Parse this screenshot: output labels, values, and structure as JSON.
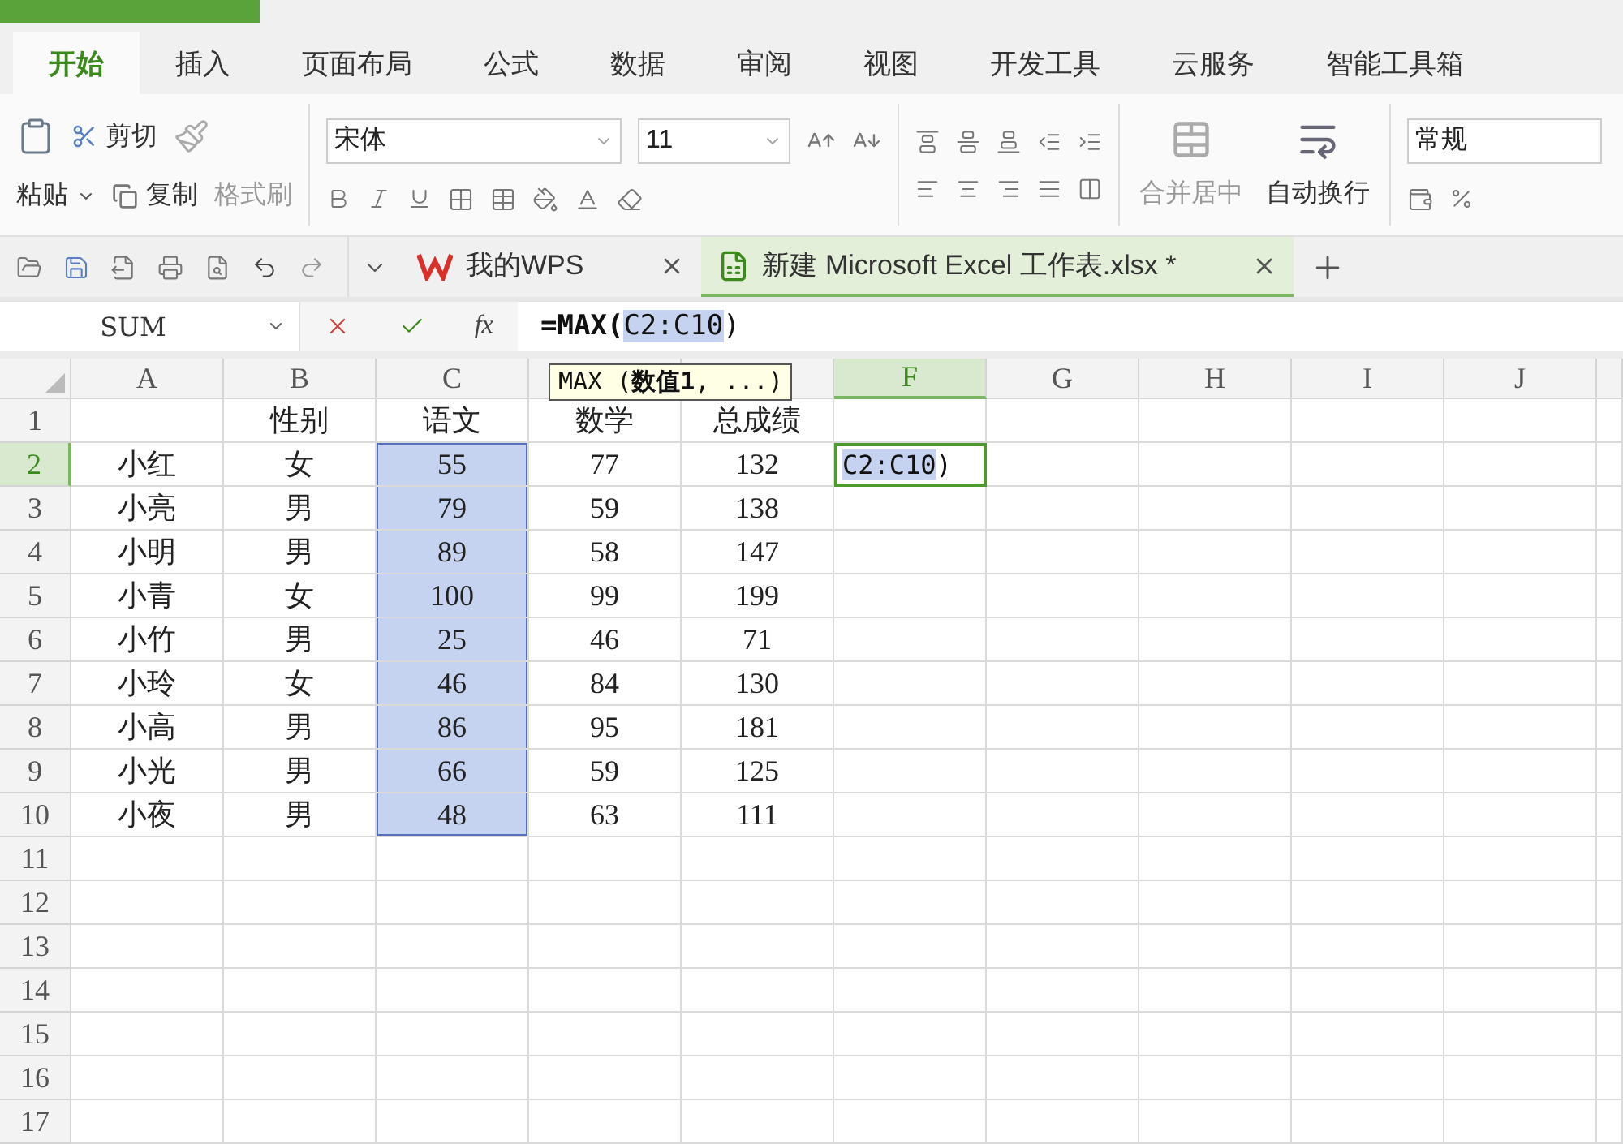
{
  "ribbon_tabs": [
    {
      "label": "开始",
      "selected": true
    },
    {
      "label": "插入",
      "selected": false
    },
    {
      "label": "页面布局",
      "selected": false
    },
    {
      "label": "公式",
      "selected": false
    },
    {
      "label": "数据",
      "selected": false
    },
    {
      "label": "审阅",
      "selected": false
    },
    {
      "label": "视图",
      "selected": false
    },
    {
      "label": "开发工具",
      "selected": false
    },
    {
      "label": "云服务",
      "selected": false
    },
    {
      "label": "智能工具箱",
      "selected": false
    }
  ],
  "clipboard": {
    "paste": "粘贴",
    "cut": "剪切",
    "copy": "复制",
    "format_painter": {
      "label": "格式刷",
      "disabled": true
    }
  },
  "font": {
    "name": "宋体",
    "size": "11"
  },
  "merge": {
    "label": "合并居中",
    "disabled": true
  },
  "wrap": {
    "label": "自动换行",
    "disabled": false
  },
  "number_format": "常规",
  "doc_tabs": [
    {
      "label": "我的WPS",
      "selected": false
    },
    {
      "label": "新建 Microsoft Excel 工作表.xlsx *",
      "selected": true
    }
  ],
  "formula_bar": {
    "name_box": "SUM",
    "function_label": "fx",
    "formula_start": "=MAX(",
    "reference": "C2:C10",
    "formula_end": ")"
  },
  "tooltip": "MAX (**数值1**, ...)",
  "columns": [
    {
      "label": "A",
      "selected": false
    },
    {
      "label": "B",
      "selected": false
    },
    {
      "label": "C",
      "selected": false
    },
    {
      "selected": false
    },
    {
      "selected": false
    },
    {
      "label": "F",
      "selected": true
    },
    {
      "label": "G",
      "selected": false
    },
    {
      "label": "H",
      "selected": false
    },
    {
      "label": "I",
      "selected": false
    },
    {
      "label": "J",
      "selected": false
    }
  ],
  "editor": {
    "reference": "C2:C10",
    "after": ")"
  },
  "rows": [
    {
      "number": "1",
      "selected": false,
      "cells": [
        {
          "highlighted": false
        },
        {
          "text": "性别",
          "highlighted": false
        },
        {
          "text": "语文",
          "highlighted": false
        },
        {
          "text": "数学",
          "highlighted": false
        },
        {
          "text": "总成绩",
          "highlighted": false
        }
      ]
    },
    {
      "number": "2",
      "selected": true,
      "cells": [
        {
          "text": "小红",
          "highlighted": false
        },
        {
          "text": "女",
          "highlighted": false
        },
        {
          "text": "55",
          "highlighted": true
        },
        {
          "text": "77",
          "highlighted": false
        },
        {
          "text": "132",
          "highlighted": false
        }
      ]
    },
    {
      "number": "3",
      "selected": false,
      "cells": [
        {
          "text": "小亮",
          "highlighted": false
        },
        {
          "text": "男",
          "highlighted": false
        },
        {
          "text": "79",
          "highlighted": true
        },
        {
          "text": "59",
          "highlighted": false
        },
        {
          "text": "138",
          "highlighted": false
        }
      ]
    },
    {
      "number": "4",
      "selected": false,
      "cells": [
        {
          "text": "小明",
          "highlighted": false
        },
        {
          "text": "男",
          "highlighted": false
        },
        {
          "text": "89",
          "highlighted": true
        },
        {
          "text": "58",
          "highlighted": false
        },
        {
          "text": "147",
          "highlighted": false
        }
      ]
    },
    {
      "number": "5",
      "selected": false,
      "cells": [
        {
          "text": "小青",
          "highlighted": false
        },
        {
          "text": "女",
          "highlighted": false
        },
        {
          "text": "100",
          "highlighted": true
        },
        {
          "text": "99",
          "highlighted": false
        },
        {
          "text": "199",
          "highlighted": false
        }
      ]
    },
    {
      "number": "6",
      "selected": false,
      "cells": [
        {
          "text": "小竹",
          "highlighted": false
        },
        {
          "text": "男",
          "highlighted": false
        },
        {
          "text": "25",
          "highlighted": true
        },
        {
          "text": "46",
          "highlighted": false
        },
        {
          "text": "71",
          "highlighted": false
        }
      ]
    },
    {
      "number": "7",
      "selected": false,
      "cells": [
        {
          "text": "小玲",
          "highlighted": false
        },
        {
          "text": "女",
          "highlighted": false
        },
        {
          "text": "46",
          "highlighted": true
        },
        {
          "text": "84",
          "highlighted": false
        },
        {
          "text": "130",
          "highlighted": false
        }
      ]
    },
    {
      "number": "8",
      "selected": false,
      "cells": [
        {
          "text": "小高",
          "highlighted": false
        },
        {
          "text": "男",
          "highlighted": false
        },
        {
          "text": "86",
          "highlighted": true
        },
        {
          "text": "95",
          "highlighted": false
        },
        {
          "text": "181",
          "highlighted": false
        }
      ]
    },
    {
      "number": "9",
      "selected": false,
      "cells": [
        {
          "text": "小光",
          "highlighted": false
        },
        {
          "text": "男",
          "highlighted": false
        },
        {
          "text": "66",
          "highlighted": true
        },
        {
          "text": "59",
          "highlighted": false
        },
        {
          "text": "125",
          "highlighted": false
        }
      ]
    },
    {
      "number": "10",
      "selected": false,
      "cells": [
        {
          "text": "小夜",
          "highlighted": false
        },
        {
          "text": "男",
          "highlighted": false
        },
        {
          "text": "48",
          "highlighted": true
        },
        {
          "text": "63",
          "highlighted": false
        },
        {
          "text": "111",
          "highlighted": false
        }
      ]
    },
    {
      "number": "11",
      "selected": false
    },
    {
      "number": "12",
      "selected": false
    },
    {
      "number": "13",
      "selected": false
    },
    {
      "number": "14",
      "selected": false
    },
    {
      "number": "15",
      "selected": false
    },
    {
      "number": "16",
      "selected": false
    },
    {
      "number": "17",
      "selected": false
    }
  ]
}
